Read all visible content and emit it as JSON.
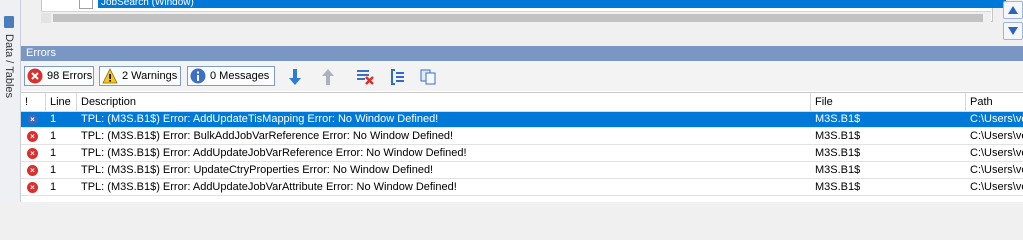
{
  "sidebar": {
    "vertical_label": "Data / Tables"
  },
  "tree": {
    "selected_item": "JobSearch (Window)"
  },
  "errors_panel": {
    "title": "Errors",
    "toolbar": {
      "errors_label": "98 Errors",
      "warnings_label": "2 Warnings",
      "messages_label": "0 Messages"
    },
    "columns": [
      "!",
      "Line",
      "Description",
      "File",
      "Path"
    ],
    "rows": [
      {
        "line": "1",
        "description": "TPL: (M3S.B1$) Error: AddUpdateTisMapping Error: No Window Defined!",
        "file": "M3S.B1$",
        "path": "C:\\Users\\ve",
        "selected": true
      },
      {
        "line": "1",
        "description": "TPL: (M3S.B1$) Error: BulkAddJobVarReference Error: No Window Defined!",
        "file": "M3S.B1$",
        "path": "C:\\Users\\ve",
        "selected": false
      },
      {
        "line": "1",
        "description": "TPL: (M3S.B1$) Error: AddUpdateJobVarReference Error: No Window Defined!",
        "file": "M3S.B1$",
        "path": "C:\\Users\\ve",
        "selected": false
      },
      {
        "line": "1",
        "description": "TPL: (M3S.B1$) Error: UpdateCtryProperties Error: No Window Defined!",
        "file": "M3S.B1$",
        "path": "C:\\Users\\ve",
        "selected": false
      },
      {
        "line": "1",
        "description": "TPL: (M3S.B1$) Error: AddUpdateJobVarAttribute Error: No Window Defined!",
        "file": "M3S.B1$",
        "path": "C:\\Users\\ve",
        "selected": false
      }
    ]
  },
  "colors": {
    "selection": "#0078d7",
    "panel_title": "#7a96c2",
    "error_red": "#d9302e"
  }
}
